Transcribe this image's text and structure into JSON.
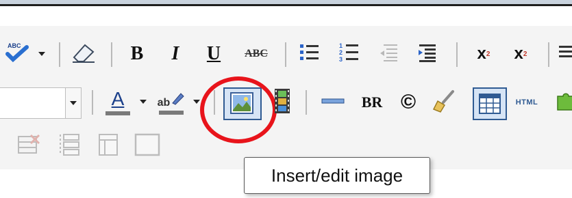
{
  "toolbar": {
    "row1": {
      "spellcheck_icon": "spellcheck-icon",
      "eraser_icon": "eraser-icon",
      "bold_label": "B",
      "italic_label": "I",
      "underline_label": "U",
      "strikethrough_label": "ABC",
      "bullet_list_icon": "bullet-list-icon",
      "numbered_list_icon": "numbered-list-icon",
      "outdent_icon": "outdent-icon",
      "indent_icon": "indent-icon",
      "superscript_label": "x",
      "superscript_mark": "2",
      "subscript_label": "x",
      "subscript_mark": "2"
    },
    "row2": {
      "font_color_label": "A",
      "highlight_label": "ab",
      "insert_image_icon": "image-icon",
      "media_icon": "film-icon",
      "hr_icon": "horizontal-rule-icon",
      "br_label": "BR",
      "copyright_label": "©",
      "cleanup_icon": "broom-icon",
      "table_icon": "table-icon",
      "html_label": "HTML",
      "plugin_icon": "puzzle-icon"
    },
    "row3": {
      "delete_table_icon": "delete-table-icon",
      "row_props_icon": "row-properties-icon",
      "cell_props_icon": "cell-properties-icon",
      "box_icon": "box-icon"
    }
  },
  "tooltip": {
    "text": "Insert/edit image"
  },
  "colors": {
    "highlight_ring": "#e8141b",
    "accent": "#2f5a92"
  }
}
